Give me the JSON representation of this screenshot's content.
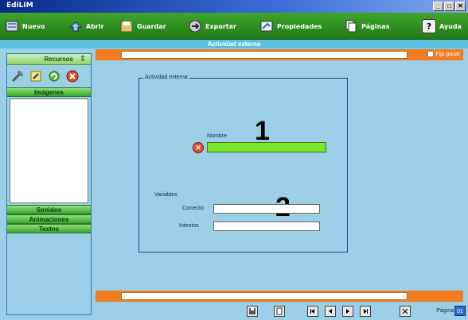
{
  "window": {
    "title": "EdiLIM",
    "buttons": [
      "_",
      "□",
      "✕"
    ]
  },
  "toolbar": {
    "items": [
      {
        "label": "Nuevo",
        "icon": "new-document-icon"
      },
      {
        "label": "Abrir",
        "icon": "open-icon"
      },
      {
        "label": "Guardar",
        "icon": "save-icon"
      },
      {
        "label": "Exportar",
        "icon": "export-icon"
      },
      {
        "label": "Propiedades",
        "icon": "properties-icon"
      },
      {
        "label": "Páginas",
        "icon": "pages-icon"
      },
      {
        "label": "Ayuda",
        "icon": "help-icon"
      }
    ]
  },
  "subheader": {
    "title": "Actividad externa"
  },
  "sidebar": {
    "resources_label": "Recursos",
    "images_label": "Imágenes",
    "sounds_label": "Sonidos",
    "animations_label": "Animaciones",
    "texts_label": "Textos"
  },
  "topbar": {
    "fijo_label": "Fijo pasar"
  },
  "form": {
    "legend": "Actividad externa",
    "nombre_label": "Nombre",
    "marker_1": "1",
    "marker_2": "2",
    "variables_label": "Variables",
    "correcto_label": "Correcto",
    "intentos_label": "Intentos",
    "delete_glyph": "✕"
  },
  "footer": {
    "pagina_label": "Página",
    "pagina_value": "01"
  },
  "colors": {
    "toolbar_green": "#2a8f22",
    "accent_orange": "#f27d1e",
    "background_blue": "#9bcfe8",
    "nombre_field_green": "#7ce52f"
  }
}
